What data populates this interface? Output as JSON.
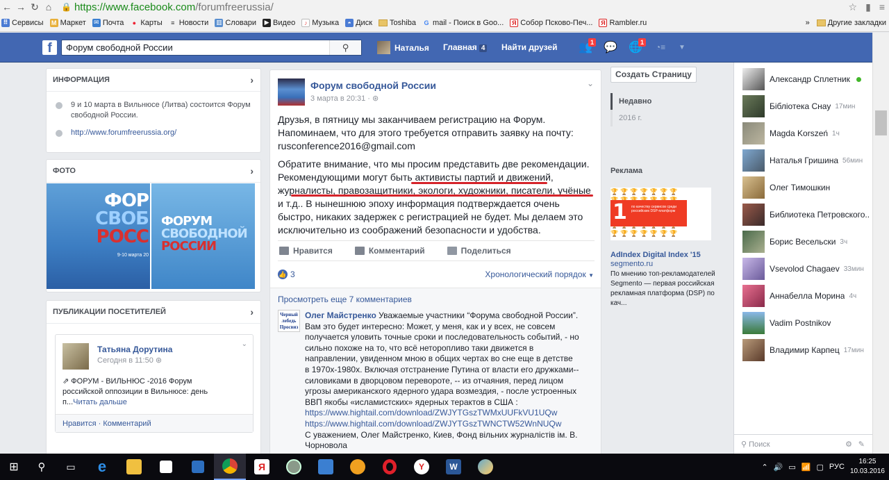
{
  "browser": {
    "url_scheme": "https://",
    "url_host": "www.facebook.com",
    "url_path": "/forumfreerussia/"
  },
  "bookmarks": [
    "Сервисы",
    "Маркет",
    "Почта",
    "Карты",
    "Новости",
    "Словари",
    "Видео",
    "Музыка",
    "Диск",
    "Toshiba",
    "mail - Поиск в Goo...",
    "Собор Псково-Печ...",
    "Rambler.ru"
  ],
  "bookmarks_more": "»",
  "bookmarks_other": "Другие закладки",
  "fb": {
    "search_value": "Форум свободной России",
    "user_name": "Наталья",
    "home_label": "Главная",
    "home_badge": "4",
    "find_friends": "Найти друзей",
    "friend_badge": "1",
    "globe_badge": "1"
  },
  "info_card": {
    "title": "ИНФОРМАЦИЯ",
    "event_text": "9 и 10 марта в Вильнюсе (Литва) состоится Форум свободной России.",
    "website": "http://www.forumfreerussia.org/"
  },
  "photo_card": {
    "title": "ФОТО",
    "photo1_lines": [
      "ФОР",
      "СВОБ",
      "РОСС"
    ],
    "photo1_caption": "9-10 марта 20",
    "photo2_lines": [
      "ФОРУМ",
      "СВОБОДНОЙ",
      "РОССИИ"
    ]
  },
  "visitor_posts": {
    "title": "ПУБЛИКАЦИИ ПОСЕТИТЕЛЕЙ",
    "author": "Татьяна Дорутина",
    "time": "Сегодня в 11:50",
    "text": "ФОРУМ - ВИЛЬНЮС -2016 Форум российской оппозиции в Вильнюсе: день п...",
    "read_more": "Читать дальше",
    "footer": "Нравится · Комментарий"
  },
  "post": {
    "page_name": "Форум свободной России",
    "time": "3 марта в 20:31 ·",
    "paragraph1": "Друзья, в пятницу мы заканчиваем регистрацию на Форум. Напоминаем, что для этого требуется отправить заявку на почту: rusconference2016@gmail.com",
    "paragraph2": "Обратите внимание, что мы просим представить две рекомендации. Рекомендующими могут быть активисты партий и движений, журналисты, правозащитники, экологи, художники, писатели, учёные и т.д.. В нынешнюю эпоху информация подтверждается очень быстро, никаких задержек с регистрацией не будет. Мы делаем это исключительно из соображений безопасности и удобства.",
    "like": "Нравится",
    "comment": "Комментарий",
    "share": "Поделиться",
    "likes_count": "3",
    "order": "Хронологический порядок",
    "more_comments": "Просмотреть еще 7 комментариев",
    "comment_author": "Олег Майстренко",
    "comment_body": "Уважаемые участники “Форума свободной России”. Вам это будет интересно: Может, у меня, как и у всех, не совсем получается уловить точные сроки и последовательность событий, - но сильно похоже на то, что всё неторопливо таки движется в направлении, увиденном мною в общих чертах во сне еще в детстве в 1970х-1980х. Включая отстранение Путина от власти его дружками--силовиками в дворцовом перевороте, -- из отчаяния, перед лицом угрозы американского ядерного удара возмездия, - после устроенных ВВП якобы «исламистских» ядерных терактов в США :",
    "link1": "https://www.hightail.com/download/ZWJYTGszTWMxUUFkVU1UQw",
    "link2": "https://www.hightail.com/download/ZWJYTGszTWNCTW52WnNUQw",
    "signature": "С уважением, Олег Майстренко, Киев, Фонд вільних журналістів ім. В. Чорновола",
    "comment_avatar_text": "Черный лебедь Просвиз"
  },
  "right": {
    "create_page": "Создать Страницу",
    "recent": "Недавно",
    "year": "2016 г.",
    "ad_label": "Реклама",
    "ad_big_number": "1",
    "ad_small_text": "по качеству сервисов среди российских DSP-платформ",
    "ad_title": "AdIndex Digital Index '15",
    "ad_domain": "segmento.ru",
    "ad_desc": "По мнению топ-рекламодателей Segmento — первая российская рекламная платформа (DSP) по кач..."
  },
  "chat": [
    {
      "name": "Александр Сплетник",
      "time": "",
      "online": true
    },
    {
      "name": "Бібліотека Снау",
      "time": "17мин",
      "online": false
    },
    {
      "name": "Magda Korszeń",
      "time": "1ч",
      "online": false
    },
    {
      "name": "Наталья Гришина",
      "time": "56мин",
      "online": false
    },
    {
      "name": "Олег Тимошкин",
      "time": "",
      "online": false
    },
    {
      "name": "Библиотека Петровского...",
      "time": "",
      "online": false
    },
    {
      "name": "Борис Весельски",
      "time": "3ч",
      "online": false
    },
    {
      "name": "Vsevolod Chagaev",
      "time": "33мин",
      "online": false
    },
    {
      "name": "Аннабелла Морина",
      "time": "4ч",
      "online": false
    },
    {
      "name": "Vadim Postnikov",
      "time": "",
      "online": false
    },
    {
      "name": "Владимир Карпец",
      "time": "17мин",
      "online": false
    }
  ],
  "chat_search": "Поиск",
  "taskbar": {
    "lang": "РУС",
    "time": "16:25",
    "date": "10.03.2016"
  }
}
